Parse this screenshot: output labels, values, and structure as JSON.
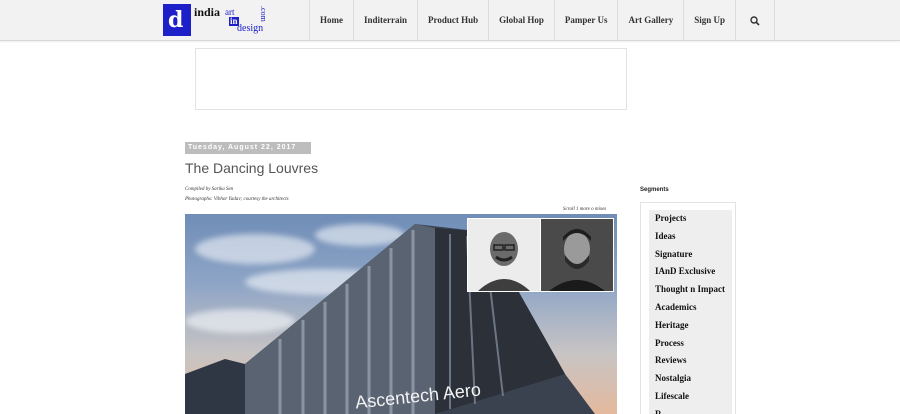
{
  "site": {
    "logo_text": {
      "india": "india",
      "art": "art",
      "in": "in",
      "design": "design",
      "com": ".com"
    }
  },
  "nav": {
    "items": [
      "Home",
      "Inditerrain",
      "Product Hub",
      "Global Hop",
      "Pamper Us",
      "Art Gallery",
      "Sign Up"
    ]
  },
  "post": {
    "date": "Tuesday, August 22, 2017",
    "title": "The Dancing Louvres",
    "credit_compiled": "Compiled by Sarika Sen",
    "credit_photo": "Photographs: Vibhor Yadav; courtesy the architects",
    "scroll_note": "Scroll 1 more o mixes",
    "building_sign": "Ascentech Aero"
  },
  "sidebar": {
    "title": "Segments",
    "items": [
      "Projects",
      "Ideas",
      "Signature",
      "IAnD Exclusive",
      "Thought n Impact",
      "Academics",
      "Heritage",
      "Process",
      "Reviews",
      "Nostalgia",
      "Lifescale",
      "R..."
    ]
  },
  "colors": {
    "brand": "#1d20c9",
    "nav_bg": "#f2f2f2",
    "date_badge_bg": "#bdbdbd",
    "segment_bg": "#eeeeee"
  },
  "icons": [
    "search-icon"
  ]
}
